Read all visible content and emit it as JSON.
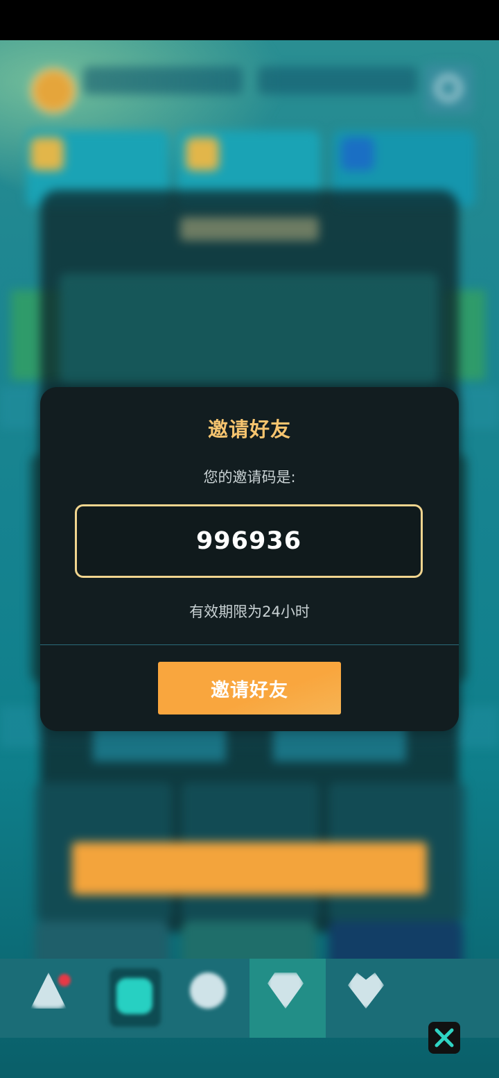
{
  "modal": {
    "title": "邀请好友",
    "code_label": "您的邀请码是:",
    "invite_code": "996936",
    "validity_note": "有效期限为24小时",
    "invite_button_label": "邀请好友"
  },
  "colors": {
    "accent_gold": "#f6c46f",
    "button_orange": "#f9a63e",
    "modal_background": "#121d20",
    "code_border": "#f1d58f"
  },
  "icons": {
    "close": "close-x-icon",
    "settings": "gear-icon"
  }
}
